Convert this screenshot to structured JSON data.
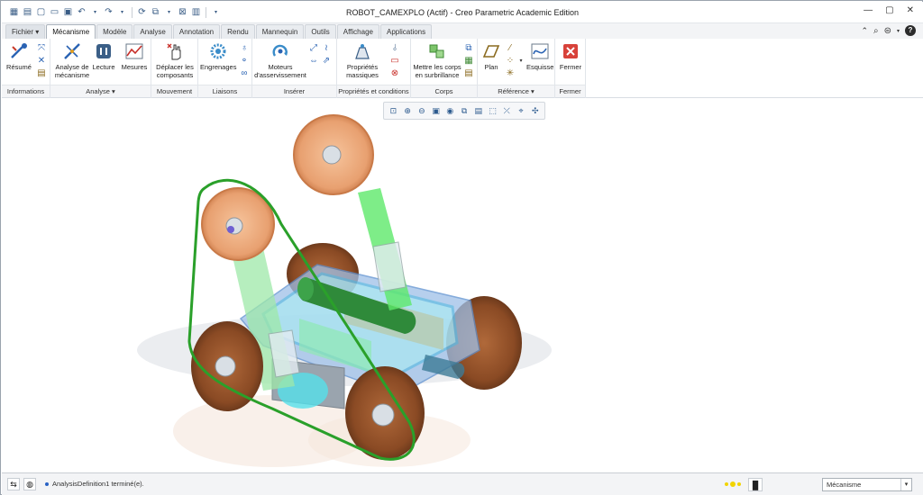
{
  "window": {
    "title": "ROBOT_CAMEXPLO (Actif) - Creo Parametric Academic Edition"
  },
  "tabs": [
    {
      "label": "Fichier ▾"
    },
    {
      "label": "Mécanisme"
    },
    {
      "label": "Modèle"
    },
    {
      "label": "Analyse"
    },
    {
      "label": "Annotation"
    },
    {
      "label": "Rendu"
    },
    {
      "label": "Mannequin"
    },
    {
      "label": "Outils"
    },
    {
      "label": "Affichage"
    },
    {
      "label": "Applications"
    }
  ],
  "ribbon": {
    "informations": {
      "label": "Informations",
      "resume": "Résumé"
    },
    "analyse": {
      "label": "Analyse",
      "analyse_btn": "Analyse de mécanisme",
      "lecture": "Lecture",
      "mesures": "Mesures"
    },
    "mouvement": {
      "label": "Mouvement",
      "deplacer": "Déplacer les composants"
    },
    "liaisons": {
      "label": "Liaisons",
      "engrenages": "Engrenages"
    },
    "inserer": {
      "label": "Insérer",
      "moteurs": "Moteurs d'asservissement"
    },
    "proprietes": {
      "label": "Propriétés et conditions",
      "masse": "Propriétés massiques"
    },
    "corps": {
      "label": "Corps",
      "mettre": "Mettre les corps en surbrillance"
    },
    "reference": {
      "label": "Référence",
      "plan": "Plan",
      "esquisse": "Esquisse"
    },
    "fermer": {
      "label": "Fermer",
      "fermer_btn": "Fermer"
    }
  },
  "status": {
    "message": "AnalysisDefinition1 terminé(e).",
    "filter": "Mécanisme"
  }
}
